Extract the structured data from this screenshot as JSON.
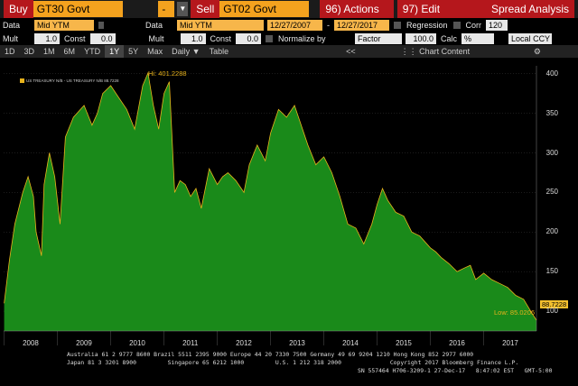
{
  "toolbar": {
    "buy_label": "Buy",
    "security1": "GT30 Govt",
    "dash": "-",
    "sell_label": "Sell",
    "security2": "GT02 Govt",
    "actions_label": "96) Actions",
    "edit_label": "97) Edit",
    "title": "Spread Analysis"
  },
  "row2": {
    "data1_label": "Data",
    "data1_value": "Mid YTM",
    "data2_label": "Data",
    "data2_value": "Mid YTM",
    "start_date": "12/27/2007",
    "end_date": "12/27/2017",
    "regression_label": "Regression",
    "corr_label": "Corr",
    "corr_value": "120"
  },
  "row3": {
    "mult1_label": "Mult",
    "mult1_value": "1.0",
    "const1_label": "Const",
    "const1_value": "0.0",
    "mult2_label": "Mult",
    "mult2_value": "1.0",
    "const2_label": "Const",
    "const2_value": "0.0",
    "normalize_label": "Normalize by",
    "factor_value": "Factor",
    "factor_num": "100.0",
    "calc_label": "Calc",
    "calc_value": "%",
    "ccy_value": "Local CCY"
  },
  "tabs": {
    "items": [
      "1D",
      "3D",
      "1M",
      "6M",
      "YTD",
      "1Y",
      "5Y",
      "Max"
    ],
    "active": "1Y",
    "daily_label": "Daily",
    "table_label": "Table",
    "collapse": "<<",
    "chart_content_label": "Chart Content"
  },
  "legend": {
    "text": "US TREASURY N/B - US TREASURY N/B 88.7228"
  },
  "annotations": {
    "hi": "Hi: 401.2288",
    "low": "Low: 85.0206",
    "last": "88.7228"
  },
  "chart_data": {
    "type": "area",
    "ylim": [
      75,
      410
    ],
    "yticks": [
      "100",
      "150",
      "200",
      "250",
      "300",
      "350",
      "400"
    ],
    "xticks": [
      "2008",
      "2009",
      "2010",
      "2011",
      "2012",
      "2013",
      "2014",
      "2015",
      "2016",
      "2017"
    ],
    "series_color": "#1a8a1a",
    "x": [
      2008.0,
      2008.1,
      2008.2,
      2008.35,
      2008.45,
      2008.55,
      2008.6,
      2008.7,
      2008.75,
      2008.85,
      2008.95,
      2009.05,
      2009.15,
      2009.3,
      2009.5,
      2009.65,
      2009.75,
      2009.85,
      2010.0,
      2010.15,
      2010.3,
      2010.45,
      2010.6,
      2010.7,
      2010.8,
      2010.9,
      2011.0,
      2011.1,
      2011.2,
      2011.3,
      2011.4,
      2011.5,
      2011.6,
      2011.7,
      2011.85,
      2012.0,
      2012.1,
      2012.2,
      2012.35,
      2012.5,
      2012.6,
      2012.75,
      2012.9,
      2013.0,
      2013.15,
      2013.3,
      2013.45,
      2013.55,
      2013.7,
      2013.85,
      2014.0,
      2014.15,
      2014.3,
      2014.45,
      2014.6,
      2014.75,
      2014.9,
      2015.0,
      2015.1,
      2015.2,
      2015.35,
      2015.5,
      2015.65,
      2015.8,
      2016.0,
      2016.1,
      2016.2,
      2016.35,
      2016.5,
      2016.65,
      2016.75,
      2016.85,
      2017.0,
      2017.15,
      2017.3,
      2017.45,
      2017.6,
      2017.75,
      2017.9,
      2017.99
    ],
    "values": [
      110,
      165,
      210,
      250,
      270,
      245,
      200,
      170,
      260,
      300,
      270,
      210,
      320,
      345,
      360,
      335,
      350,
      375,
      385,
      370,
      355,
      330,
      385,
      401,
      360,
      330,
      375,
      390,
      250,
      265,
      260,
      245,
      255,
      230,
      280,
      260,
      270,
      275,
      265,
      250,
      285,
      310,
      290,
      325,
      355,
      345,
      360,
      340,
      310,
      285,
      295,
      275,
      245,
      210,
      205,
      185,
      210,
      235,
      255,
      240,
      225,
      220,
      200,
      195,
      180,
      175,
      168,
      160,
      150,
      155,
      158,
      140,
      148,
      140,
      135,
      130,
      120,
      115,
      98,
      88.7
    ]
  },
  "footer": {
    "line1": "Australia 61 2 9777 8600 Brazil 5511 2395 9000 Europe 44 20 7330 7500 Germany 49 69 9204 1210 Hong Kong 852 2977 6000",
    "line2": "Japan 81 3 3201 8900         Singapore 65 6212 1000         U.S. 1 212 318 2000              Copyright 2017 Bloomberg Finance L.P.",
    "line3": "SN 557464 H706-3209-1 27-Dec-17   8:47:02 EST   GMT-5:00"
  }
}
